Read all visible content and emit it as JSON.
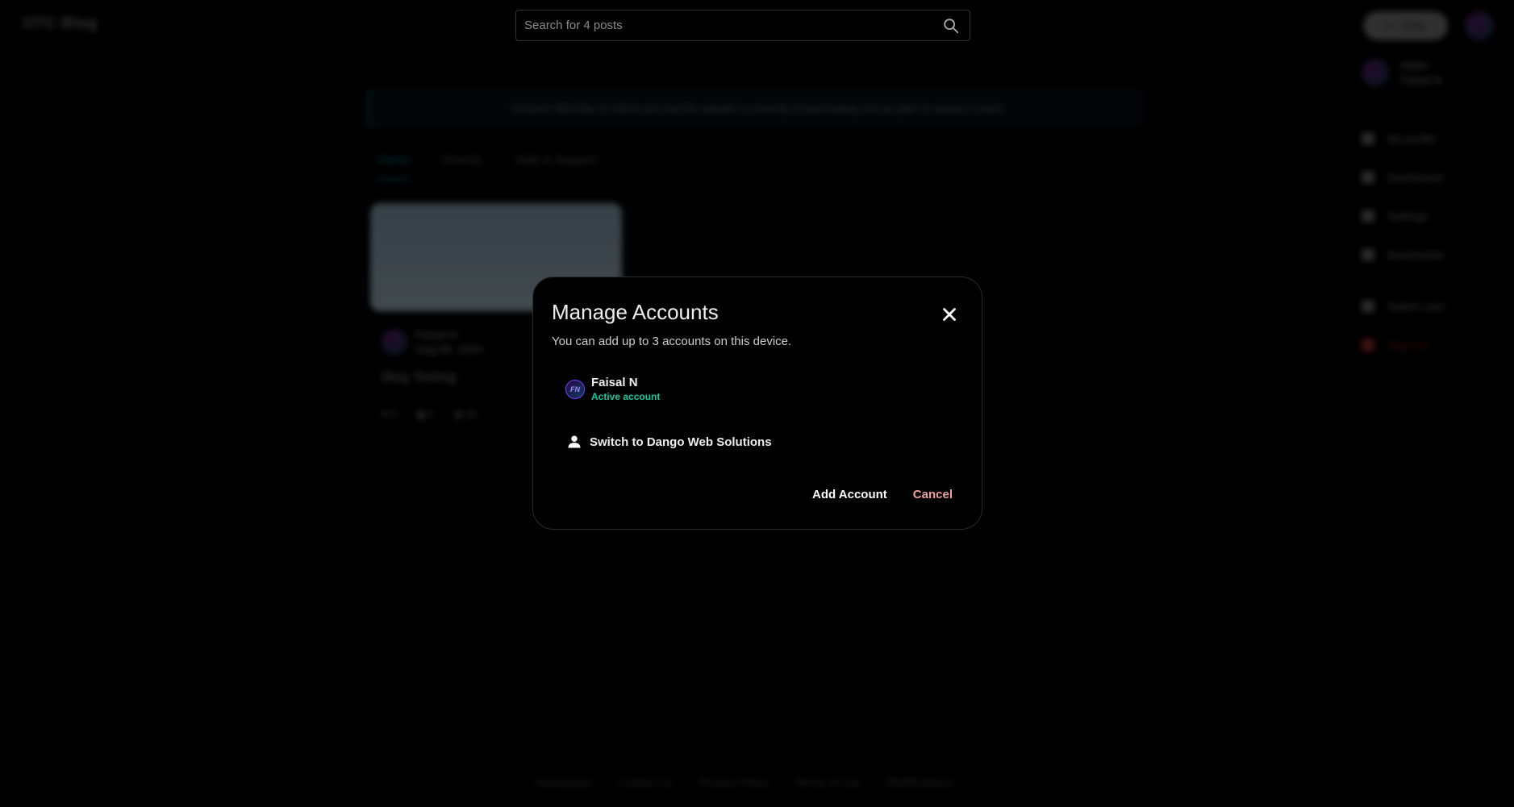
{
  "header": {
    "logo": "OTC Blog",
    "search_placeholder": "Search for 4 posts",
    "write_label": "Write"
  },
  "sidebar": {
    "user_greeting": "Hello!",
    "user_name": "Faisal N",
    "items": [
      {
        "label": "My profile"
      },
      {
        "label": "Dashboard"
      },
      {
        "label": "Settings"
      },
      {
        "label": "Bookmarks"
      },
      {
        "label": "Switch user"
      },
      {
        "label": "Sign out"
      }
    ]
  },
  "banner": {
    "text": "Hi there! We'd like to inform you that the website is currently in beta testing, but we plan to release it soon!"
  },
  "tabs": [
    {
      "label": "Home"
    },
    {
      "label": "Friends"
    },
    {
      "label": "Help & Support"
    }
  ],
  "post": {
    "author": "Faisal N",
    "date": "Aug 06, 2024",
    "title": "Blog Testing",
    "likes": "0",
    "comments": "0",
    "views": "20"
  },
  "footer": {
    "links": [
      "Homepage",
      "Contact Us",
      "Privacy Policy",
      "Terms of Use",
      "Modifications"
    ]
  },
  "modal": {
    "title": "Manage Accounts",
    "subtitle": "You can add up to 3 accounts on this device.",
    "active_account": {
      "initials": "FN",
      "name": "Faisal N",
      "status": "Active account"
    },
    "switch_label": "Switch to Dango Web Solutions",
    "add_account_label": "Add Account",
    "cancel_label": "Cancel"
  }
}
